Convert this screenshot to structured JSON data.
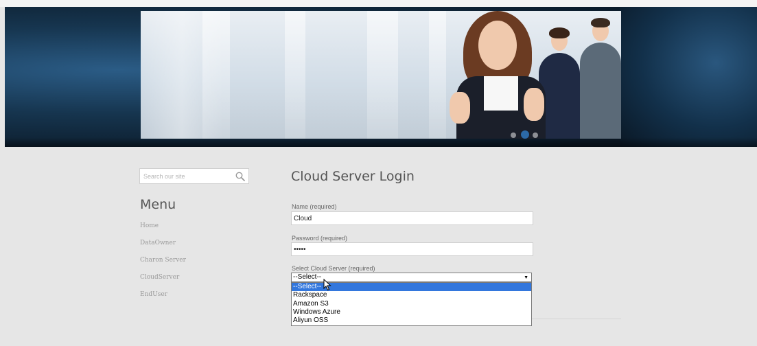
{
  "search": {
    "placeholder": "Search our site"
  },
  "menu": {
    "title": "Menu",
    "items": [
      "Home",
      "DataOwner",
      "Charon Server",
      "CloudServer",
      "EndUser"
    ]
  },
  "form": {
    "title": "Cloud Server Login",
    "name_label": "Name (required)",
    "name_value": "Cloud",
    "password_label": "Password (required)",
    "password_value": "•••••",
    "server_label": "Select Cloud Server (required)",
    "server_selected": "--Select--",
    "server_options": [
      "--Select--",
      "Rackspace",
      "Amazon S3",
      "Windows Azure",
      "Aliyun OSS"
    ]
  },
  "colors": {
    "accent": "#3377dd",
    "header_dark": "#0c1c2c",
    "slider_dot": "#2c6aa8"
  },
  "icons": {
    "search": "magnifier-icon",
    "cursor": "mouse-pointer-icon",
    "dropdown": "triangle-down-icon"
  }
}
